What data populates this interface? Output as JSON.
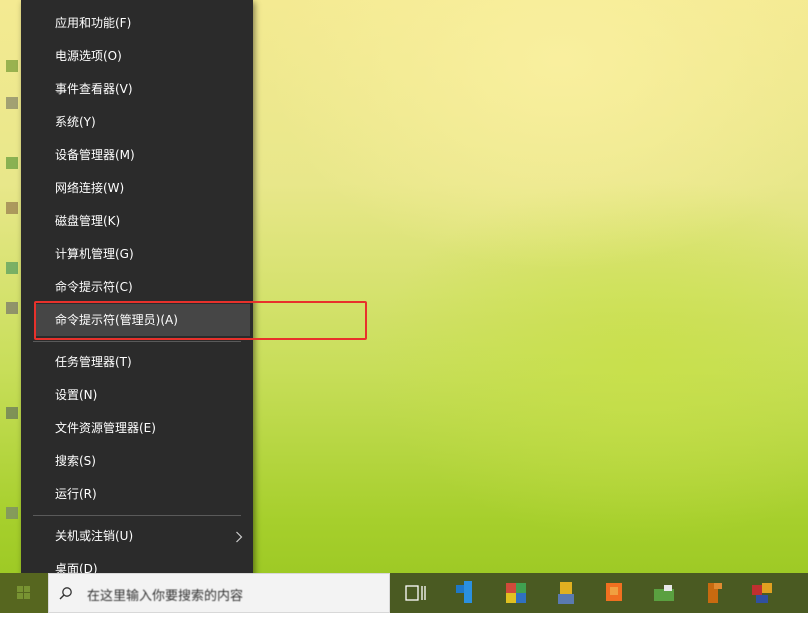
{
  "context_menu": {
    "items": [
      {
        "label": "应用和功能(F)",
        "name": "menu-item-apps-features"
      },
      {
        "label": "电源选项(O)",
        "name": "menu-item-power-options"
      },
      {
        "label": "事件查看器(V)",
        "name": "menu-item-event-viewer"
      },
      {
        "label": "系统(Y)",
        "name": "menu-item-system"
      },
      {
        "label": "设备管理器(M)",
        "name": "menu-item-device-manager"
      },
      {
        "label": "网络连接(W)",
        "name": "menu-item-network-connections"
      },
      {
        "label": "磁盘管理(K)",
        "name": "menu-item-disk-management"
      },
      {
        "label": "计算机管理(G)",
        "name": "menu-item-computer-management"
      },
      {
        "label": "命令提示符(C)",
        "name": "menu-item-command-prompt"
      },
      {
        "label": "命令提示符(管理员)(A)",
        "name": "menu-item-command-prompt-admin"
      },
      {
        "label": "任务管理器(T)",
        "name": "menu-item-task-manager"
      },
      {
        "label": "设置(N)",
        "name": "menu-item-settings"
      },
      {
        "label": "文件资源管理器(E)",
        "name": "menu-item-file-explorer"
      },
      {
        "label": "搜索(S)",
        "name": "menu-item-search"
      },
      {
        "label": "运行(R)",
        "name": "menu-item-run"
      },
      {
        "label": "关机或注销(U)",
        "name": "menu-item-shutdown-signout"
      },
      {
        "label": "桌面(D)",
        "name": "menu-item-desktop"
      }
    ],
    "hovered_index": 9,
    "submenu_arrow": "›"
  },
  "taskbar": {
    "search_placeholder": "在这里输入你要搜索的内容",
    "apps": [
      {
        "icon": "blue-app-icon",
        "color": "#1e78c8"
      },
      {
        "icon": "colorful-app-icon",
        "color": "#d04a3a"
      },
      {
        "icon": "yellow-app-icon",
        "color": "#e0b020"
      },
      {
        "icon": "orange-app-icon",
        "color": "#f07020"
      },
      {
        "icon": "green-app-icon",
        "color": "#5aa040"
      },
      {
        "icon": "brown-app-icon",
        "color": "#c86a10"
      },
      {
        "icon": "multi-app-icon",
        "color": "#c03030"
      }
    ]
  },
  "annotation": {
    "highlight_color": "#e8312b"
  }
}
